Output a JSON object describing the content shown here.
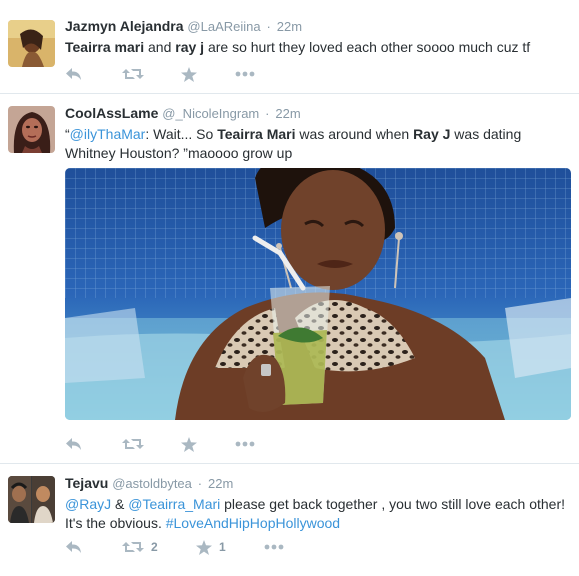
{
  "tweets": [
    {
      "fullname": "Jazmyn Alejandra",
      "username": "@LaAReiina",
      "time": "22m",
      "text": [
        {
          "t": "Teairra mari",
          "b": true
        },
        {
          "t": " and "
        },
        {
          "t": "ray j",
          "b": true
        },
        {
          "t": " are so hurt they loved each other soooo much cuz tf"
        }
      ],
      "retweets": "",
      "favorites": ""
    },
    {
      "fullname": "CoolAssLame",
      "username": "@_NicoleIngram",
      "time": "22m",
      "text": [
        {
          "t": "“"
        },
        {
          "t": "@ilyThaMar",
          "link": true
        },
        {
          "t": ": Wait... So "
        },
        {
          "t": "Teairra Mari",
          "b": true
        },
        {
          "t": " was around when "
        },
        {
          "t": "Ray J",
          "b": true
        },
        {
          "t": " was dating Whitney Houston? ”maoooo grow up"
        }
      ],
      "retweets": "",
      "favorites": ""
    },
    {
      "fullname": "Tejavu",
      "username": "@astoldbytea",
      "time": "22m",
      "text": [
        {
          "t": "@RayJ",
          "link": true
        },
        {
          "t": " & "
        },
        {
          "t": "@Teairra_Mari",
          "link": true
        },
        {
          "t": " please get back together , you two still love each other! It's the obvious. "
        },
        {
          "t": "#LoveAndHipHopHollywood",
          "link": true
        }
      ],
      "retweets": "2",
      "favorites": "1"
    }
  ],
  "colors": {
    "link": "#3b94d9",
    "meta": "#8899a6",
    "icon": "#aab8c2",
    "border": "#e1e8ed"
  }
}
